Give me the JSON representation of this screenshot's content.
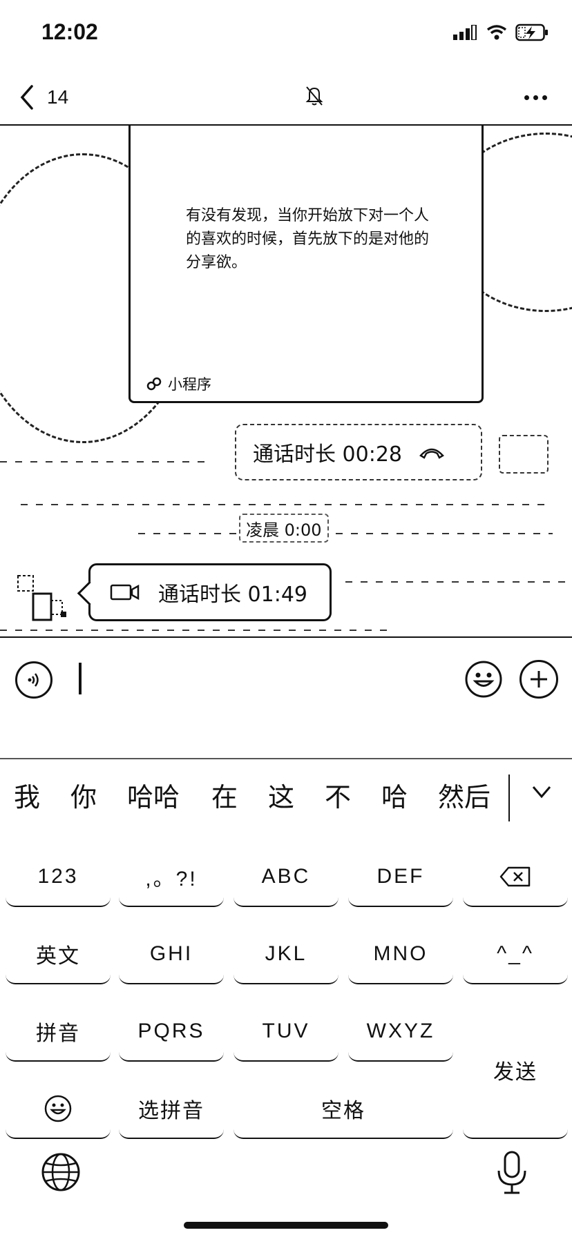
{
  "status_bar": {
    "time": "12:02"
  },
  "nav": {
    "back_count": "14"
  },
  "chat": {
    "mini_program_card": {
      "text": "有没有发现，当你开始放下对一个人的喜欢的时候，首先放下的是对他的分享欲。",
      "footer": "小程序"
    },
    "outgoing_call": {
      "label": "通话时长 00:28"
    },
    "timestamp": "凌晨 0:00",
    "incoming_call": {
      "label": "通话时长 01:49"
    }
  },
  "keyboard": {
    "candidates": [
      "我",
      "你",
      "哈哈",
      "在",
      "这",
      "不",
      "哈",
      "然后"
    ],
    "rows": [
      [
        "123",
        ",。?!",
        "ABC",
        "DEF"
      ],
      [
        "英文",
        "GHI",
        "JKL",
        "MNO",
        "^_^"
      ],
      [
        "拼音",
        "PQRS",
        "TUV",
        "WXYZ"
      ],
      [
        "选拼音",
        "空格"
      ]
    ],
    "send_label": "发送"
  }
}
